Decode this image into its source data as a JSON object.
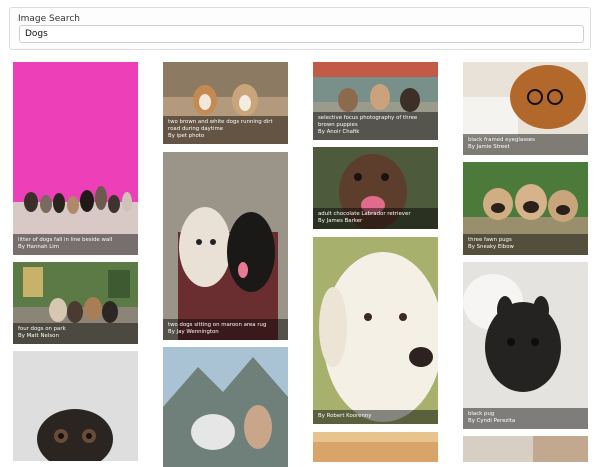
{
  "search": {
    "label": "Image Search",
    "value": "Dogs"
  },
  "results": [
    {
      "desc": "litter of dogs fall in line beside wall",
      "author": "By Hannah Lim"
    },
    {
      "desc": "four dogs on park",
      "author": "By Matt Nelson"
    },
    {
      "desc": "two brown and white dogs running dirt road during daytime",
      "author": "By ipet photo"
    },
    {
      "desc": "two dogs sitting on maroon area rug",
      "author": "By Jay Wennington"
    },
    {
      "desc": "selective focus photography of three brown puppies",
      "author": "By Anoir Chafik"
    },
    {
      "desc": "adult chocolate Labrador retriever",
      "author": "By James Barker"
    },
    {
      "desc": "",
      "author": "By Robert Koorenny"
    },
    {
      "desc": "black framed eyeglasses",
      "author": "By Jamie Street"
    },
    {
      "desc": "three fawn pugs",
      "author": "By Sneaky Elbow"
    },
    {
      "desc": "black pug",
      "author": "By Cyndi Perezita"
    }
  ]
}
